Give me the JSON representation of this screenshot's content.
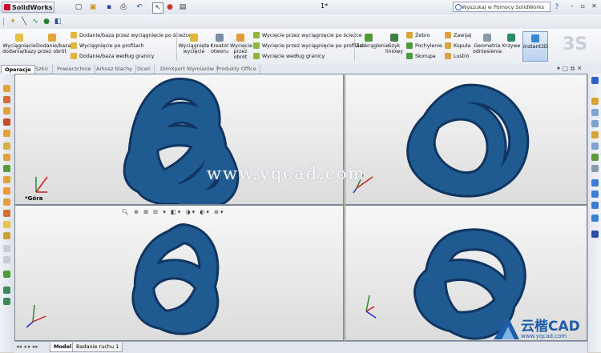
{
  "app": {
    "logo_text": "SolidWorks",
    "document_title": "1*"
  },
  "search": {
    "value": "Wyszukaj w Pomocy SolidWorks"
  },
  "command_manager": {
    "group1": {
      "big1": "Wyciągnięcie dodania/bazy",
      "big2": "Dodanie/baza przez obrót",
      "rows": [
        "Dodanie/baza przez wyciągnięcie po ścieżce",
        "Wyciągnięcie po profilach",
        "Dodanie/baza według granicy"
      ]
    },
    "group2": {
      "big1": "Wyciągnięte wycięcie",
      "big2": "Kreator otworu",
      "big3": "Wycięcie przez obrót",
      "rows": [
        "Wycięcie przez wyciągnięcie po ścieżce",
        "Wycięcie przez wyciągnięcie po profilach",
        "Wycięcie według granicy"
      ]
    },
    "group3": {
      "big1": "Zaokrąglenie",
      "big2": "Szyk liniowy",
      "col1": [
        "Żebro",
        "Pochylenie",
        "Skorupa"
      ],
      "col2": [
        "Zawijaj",
        "Kopuła",
        "Lustro"
      ],
      "big3": "Geometria odniesienia",
      "big4": "Krzywe",
      "big5": "Instant3D"
    }
  },
  "tabs": [
    "Operacje",
    "Szkic",
    "Powierzchnie",
    "Arkusz blachy",
    "Oceń",
    "DimXpert Wymiarów",
    "Produkty Office"
  ],
  "viewport_labels": {
    "top_left_view": "*Góra"
  },
  "watermark": "www.yqcad.com",
  "bottom_tabs": [
    "Model",
    "Badanie ruchu 1"
  ],
  "brand": {
    "name": "云楷CAD",
    "url": "www.yqcad.com"
  },
  "colors": {
    "knot_blue": "#1f5a91",
    "knot_dark": "#0f3560",
    "accent_blue": "#1e5ba8"
  }
}
